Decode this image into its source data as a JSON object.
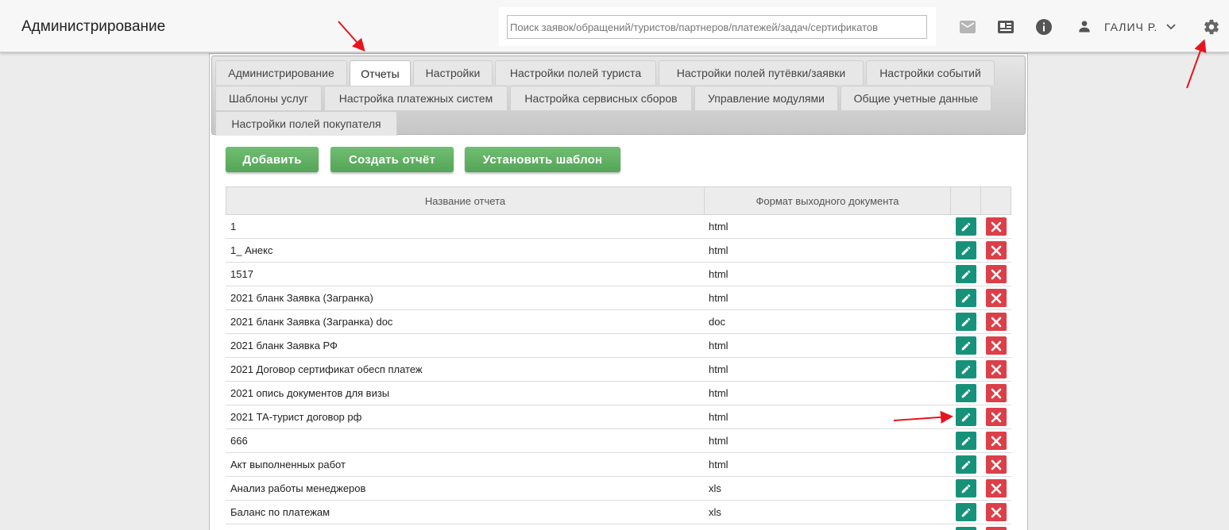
{
  "header": {
    "title": "Администрирование",
    "search_placeholder": "Поиск заявок/обращений/туристов/партнеров/платежей/задач/сертификатов",
    "user_name": "ГАЛИЧ Р."
  },
  "tabs": [
    {
      "label": "Администрирование",
      "active": false
    },
    {
      "label": "Отчеты",
      "active": true
    },
    {
      "label": "Настройки",
      "active": false
    },
    {
      "label": "Настройки полей туриста",
      "active": false
    },
    {
      "label": "Настройки полей путёвки/заявки",
      "active": false
    },
    {
      "label": "Настройки событий",
      "active": false
    },
    {
      "label": "Шаблоны услуг",
      "active": false
    },
    {
      "label": "Настройка платежных систем",
      "active": false
    },
    {
      "label": "Настройка сервисных сборов",
      "active": false
    },
    {
      "label": "Управление модулями",
      "active": false
    },
    {
      "label": "Общие учетные данные",
      "active": false
    },
    {
      "label": "Настройки полей покупателя",
      "active": false
    }
  ],
  "toolbar": {
    "add_label": "Добавить",
    "create_report_label": "Создать отчёт",
    "set_template_label": "Установить шаблон"
  },
  "table": {
    "columns": [
      "Название отчета",
      "Формат выходного документа"
    ],
    "rows": [
      {
        "name": "1",
        "format": "html"
      },
      {
        "name": "1_ Анекс",
        "format": "html"
      },
      {
        "name": "1517",
        "format": "html"
      },
      {
        "name": "2021 бланк Заявка (Загранка)",
        "format": "html"
      },
      {
        "name": "2021 бланк Заявка (Загранка) doc",
        "format": "doc"
      },
      {
        "name": "2021 бланк Заявка РФ",
        "format": "html"
      },
      {
        "name": "2021 Договор сертификат обесп платеж",
        "format": "html"
      },
      {
        "name": "2021 опись документов для визы",
        "format": "html"
      },
      {
        "name": "2021 ТА-турист договор рф",
        "format": "html"
      },
      {
        "name": "666",
        "format": "html"
      },
      {
        "name": "Акт выполненных работ",
        "format": "html"
      },
      {
        "name": "Анализ работы менеджеров",
        "format": "xls"
      },
      {
        "name": "Баланс по платежам",
        "format": "xls"
      },
      {
        "name": "",
        "format": ""
      }
    ]
  },
  "icons": {
    "mail": "mail-icon",
    "news": "newspaper-icon",
    "info": "info-icon",
    "user": "person-icon",
    "chevron": "chevron-down-icon",
    "settings": "gear-icon",
    "edit": "pencil-icon",
    "delete": "close-icon"
  },
  "colors": {
    "button_green": "#5cb860",
    "edit_teal": "#17927a",
    "delete_red": "#dc3f48",
    "annotation_red": "#e8141c"
  }
}
